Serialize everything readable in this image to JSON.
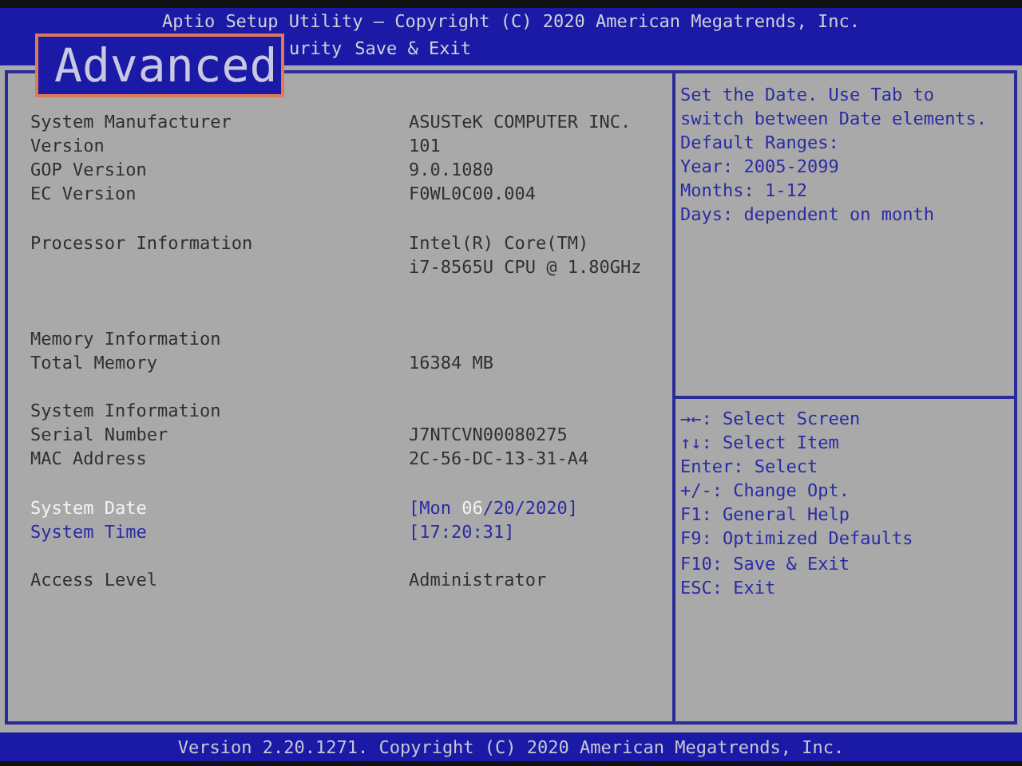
{
  "title_bar": {
    "title": "Aptio Setup Utility – Copyright (C) 2020 American Megatrends, Inc."
  },
  "tabs": [
    {
      "label": "urity",
      "selected": false
    },
    {
      "label": "Save & Exit",
      "selected": false
    }
  ],
  "callout": {
    "label": "Advanced"
  },
  "rows": [
    {
      "kind": "blank"
    },
    {
      "kind": "info",
      "label": "System Manufacturer",
      "value": [
        "ASUSTeK COMPUTER INC."
      ]
    },
    {
      "kind": "info",
      "label": "Version",
      "value": [
        "101"
      ]
    },
    {
      "kind": "info",
      "label": "GOP Version",
      "value": [
        "9.0.1080"
      ]
    },
    {
      "kind": "info",
      "label": "EC Version",
      "value": [
        "F0WL0C00.004"
      ]
    },
    {
      "kind": "blank"
    },
    {
      "kind": "info",
      "label": "Processor Information",
      "value": [
        "Intel(R) Core(TM)",
        "i7-8565U CPU @ 1.80GHz"
      ]
    },
    {
      "kind": "blank"
    },
    {
      "kind": "blank"
    },
    {
      "kind": "info",
      "label": "Memory Information"
    },
    {
      "kind": "info",
      "label": "Total Memory",
      "value": [
        "16384 MB"
      ]
    },
    {
      "kind": "blank"
    },
    {
      "kind": "info",
      "label": "System Information"
    },
    {
      "kind": "info",
      "label": "Serial Number",
      "value": [
        "J7NTCVN00080275"
      ]
    },
    {
      "kind": "info",
      "label": "MAC Address",
      "value": [
        "2C-56-DC-13-31-A4"
      ]
    },
    {
      "kind": "blank"
    },
    {
      "kind": "setting",
      "label": "System Date",
      "selected": true,
      "parts": [
        {
          "text": "[Mon ",
          "selected": false
        },
        {
          "text": "06",
          "selected": true
        },
        {
          "text": "/20/2020]",
          "selected": false
        }
      ]
    },
    {
      "kind": "setting",
      "label": "System Time",
      "selected": false,
      "parts": [
        {
          "text": "[17:20:31]",
          "selected": false
        }
      ]
    },
    {
      "kind": "blank"
    },
    {
      "kind": "info",
      "label": "Access Level",
      "value": [
        "Administrator"
      ]
    }
  ],
  "help": [
    "Set the Date. Use Tab to",
    "switch between Date elements.",
    "Default Ranges:",
    "Year: 2005-2099",
    "Months: 1-12",
    "Days: dependent on month"
  ],
  "keys": [
    "→←: Select Screen",
    "↑↓: Select Item",
    "Enter: Select",
    "+/-: Change Opt.",
    "F1: General Help",
    "F9: Optimized Defaults",
    "F10: Save & Exit",
    "ESC: Exit"
  ],
  "footer": "Version 2.20.1271. Copyright (C) 2020 American Megatrends, Inc."
}
